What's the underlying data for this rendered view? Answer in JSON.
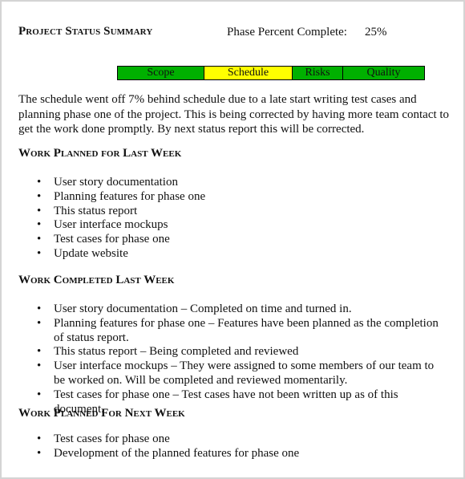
{
  "header": {
    "title": "Project Status Summary",
    "phase_percent_label": "Phase Percent Complete:",
    "phase_percent_value": "25%"
  },
  "status_table": {
    "cells": [
      {
        "label": "Scope",
        "status": "green",
        "color": "#00b000"
      },
      {
        "label": "Schedule",
        "status": "yellow",
        "color": "#ffff00"
      },
      {
        "label": "Risks",
        "status": "green",
        "color": "#00b000"
      },
      {
        "label": "Quality",
        "status": "green",
        "color": "#00b000"
      }
    ]
  },
  "summary": "The schedule went off 7% behind schedule due to a late start writing test cases and planning phase one of the project. This is being corrected by having more team contact to get the work done promptly. By next status report this will be corrected.",
  "sections": [
    {
      "heading": "Work Planned for Last Week",
      "items": [
        "User story documentation",
        "Planning features for phase one",
        "This status report",
        "User interface mockups",
        "Test cases for phase one",
        "Update website"
      ]
    },
    {
      "heading": "Work Completed Last Week",
      "items": [
        "User story documentation – Completed on time and turned in.",
        "Planning features for phase one – Features have been planned as the completion of status report.",
        "This status report – Being completed and reviewed",
        "User interface mockups – They were assigned to some members of our team to be worked on. Will be completed and reviewed momentarily.",
        "Test cases for phase one – Test cases have not been written up as of this document."
      ]
    },
    {
      "heading": "Work Planned For Next Week",
      "items": [
        "Test cases for phase one",
        "Development of the planned features for phase one"
      ]
    }
  ],
  "bullet_glyph": "•"
}
